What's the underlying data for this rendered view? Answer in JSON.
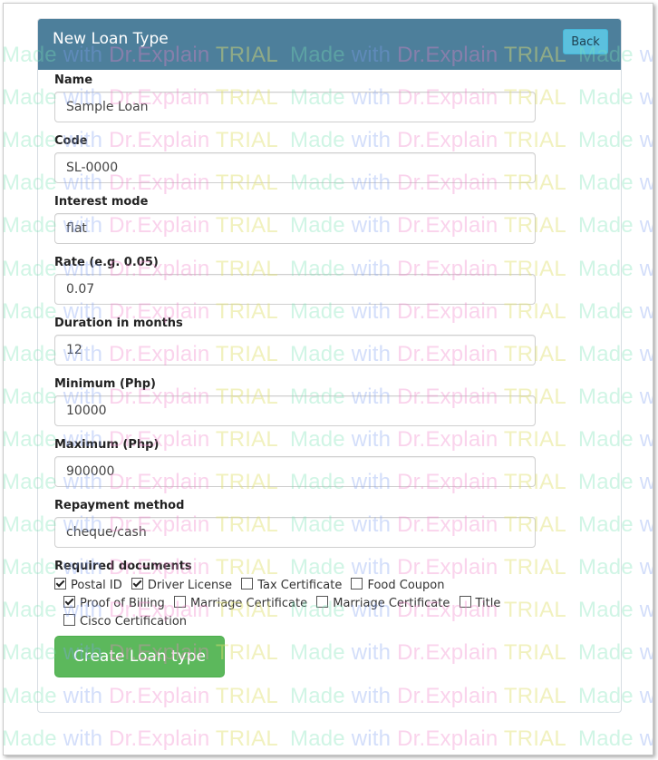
{
  "header": {
    "title": "New Loan Type",
    "back_label": "Back"
  },
  "fields": {
    "name": {
      "label": "Name",
      "value": "Sample Loan"
    },
    "code": {
      "label": "Code",
      "value": "SL-0000"
    },
    "interest": {
      "label": "Interest mode",
      "value": "flat"
    },
    "rate": {
      "label": "Rate (e.g. 0.05)",
      "value": "0.07"
    },
    "duration": {
      "label": "Duration in months",
      "value": "12"
    },
    "minimum": {
      "label": "Minimum (Php)",
      "value": "10000"
    },
    "maximum": {
      "label": "Maximum (Php)",
      "value": "900000"
    },
    "repayment": {
      "label": "Repayment method",
      "value": "cheque/cash"
    }
  },
  "documents": {
    "label": "Required documents",
    "items": [
      {
        "label": "Postal ID",
        "checked": true
      },
      {
        "label": "Driver License",
        "checked": true
      },
      {
        "label": "Tax Certificate",
        "checked": false
      },
      {
        "label": "Food Coupon",
        "checked": false
      },
      {
        "label": "Proof of Billing",
        "checked": true
      },
      {
        "label": "Marriage Certificate",
        "checked": false
      },
      {
        "label": "Marriage Certificate",
        "checked": false
      },
      {
        "label": "Title",
        "checked": false
      },
      {
        "label": "Cisco Certification",
        "checked": false
      }
    ]
  },
  "submit_label": "Create Loan type",
  "watermark": {
    "made": "Made",
    "with": "with",
    "dr": "Dr.Explain",
    "trial": "TRIAL"
  }
}
